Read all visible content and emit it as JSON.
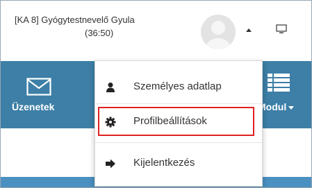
{
  "header": {
    "user_line1": "[KA 8] Gyógytestnevelő Gyula",
    "user_line2": "(36:50)",
    "avatar_icon": "user-avatar-icon",
    "caret_icon": "caret-up-icon",
    "monitor_icon": "monitor-icon"
  },
  "nav": {
    "messages_label": "Üzenetek",
    "messages_icon": "envelope-icon",
    "modul_label": "Modul",
    "modul_icon": "list-icon"
  },
  "menu": {
    "items": [
      {
        "label": "Személyes adatlap",
        "icon": "user-icon"
      },
      {
        "label": "Profilbeállítások",
        "icon": "gear-icon"
      },
      {
        "label": "Kijelentkezés",
        "icon": "sign-out-icon"
      }
    ]
  },
  "colors": {
    "nav_bg": "#3d7fa7",
    "highlight": "#e02020"
  }
}
